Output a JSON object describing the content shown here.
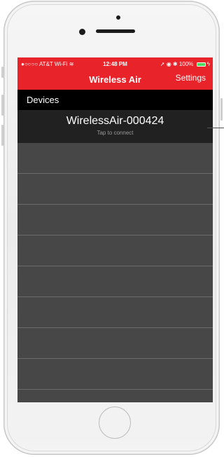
{
  "status_bar": {
    "carrier": "●○○○○ AT&T Wi-Fi ≋",
    "time": "12:48 PM",
    "right_status": "➚ ◉ ✱ 100%"
  },
  "nav_bar": {
    "title": "Wireless Air",
    "settings_label": "Settings"
  },
  "devices_section": {
    "header": "Devices",
    "items": [
      {
        "name": "WirelessAir-000424",
        "subtitle": "Tap to connect"
      }
    ]
  },
  "colors": {
    "accent_red": "#e8232a",
    "list_background": "#474747",
    "device_cell": "#212121",
    "section_header": "#000000",
    "battery_green": "#4cd964"
  },
  "icons": [
    "wifi-icon",
    "location-icon",
    "lock-rotation-icon",
    "bluetooth-icon",
    "battery-icon",
    "charging-icon"
  ]
}
